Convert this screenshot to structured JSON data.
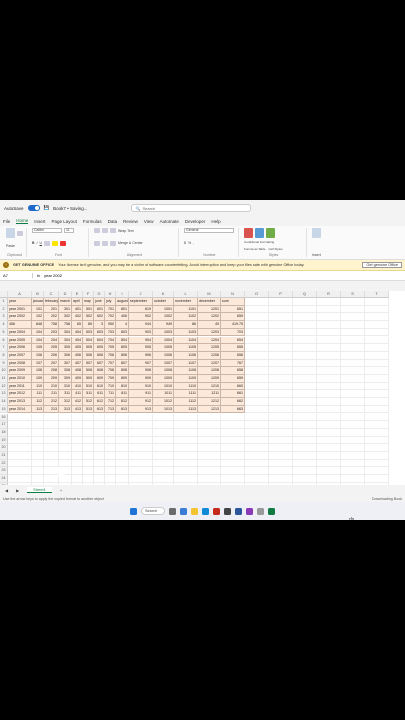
{
  "title": {
    "autosave_label": "AutoSave",
    "toggle_state": "On",
    "doc_name": "Book7 • Saving...",
    "search_placeholder": "Search"
  },
  "menu_tabs": [
    "File",
    "Home",
    "Insert",
    "Page Layout",
    "Formulas",
    "Data",
    "Review",
    "View",
    "Automate",
    "Developer",
    "Help"
  ],
  "active_tab": "Home",
  "ribbon": {
    "clipboard": "Clipboard",
    "paste": "Paste",
    "font_name": "Calibri",
    "font_size": "11",
    "font": "Font",
    "alignment": "Alignment",
    "wrap_text": "Wrap Text",
    "merge_center": "Merge & Center",
    "number_format": "General",
    "number": "Number",
    "conditional": "Conditional Formatting",
    "format_table": "Format as Table",
    "cell_styles": "Cell Styles",
    "styles": "Styles",
    "insert": "Insert",
    "undo": "Undo"
  },
  "banner": {
    "label": "GET GENUINE OFFICE",
    "message": "Your license isn't genuine, and you may be a victim of software counterfeiting. Avoid interruption and keep your files safe with genuine Office today.",
    "button": "Get genuine Office"
  },
  "formula_bar": {
    "name_box": "A7",
    "fx": "fx",
    "value": "year 2002"
  },
  "columns": [
    "A",
    "B",
    "C",
    "D",
    "E",
    "F",
    "G",
    "H",
    "I",
    "J",
    "K",
    "L",
    "M",
    "N",
    "O",
    "P",
    "Q",
    "R",
    "S",
    "T"
  ],
  "rows": [
    "1",
    "2",
    "3",
    "4",
    "5",
    "6",
    "7",
    "8",
    "9",
    "10",
    "11",
    "12",
    "13",
    "14",
    "15",
    "16",
    "17",
    "18",
    "19",
    "20",
    "21",
    "22",
    "23",
    "24",
    "25"
  ],
  "sheet": {
    "header": [
      "year",
      "january",
      "february",
      "march",
      "april",
      "may",
      "june",
      "july",
      "august",
      "september",
      "october",
      "november",
      "december",
      "sum"
    ],
    "data": [
      [
        "year 2001",
        "101",
        "201",
        "301",
        "401",
        "501",
        "601",
        "701",
        "801",
        "819",
        "1001",
        "1101",
        "1201",
        "651"
      ],
      [
        "year 2002",
        "102",
        "202",
        "302",
        "402",
        "502",
        "602",
        "702",
        "406",
        "902",
        "1002",
        "1102",
        "1202",
        "659"
      ],
      [
        "456",
        "848",
        "758",
        "758",
        "65",
        "85",
        "3",
        "950",
        "4",
        "944",
        "949",
        "86",
        "49",
        "419.75"
      ],
      [
        "year 2004",
        "104",
        "203",
        "304",
        "404",
        "503",
        "603",
        "703",
        "803",
        "903",
        "1003",
        "1103",
        "1203",
        "703"
      ],
      [
        "year 2005",
        "104",
        "204",
        "304",
        "404",
        "504",
        "604",
        "704",
        "804",
        "904",
        "1004",
        "1104",
        "1204",
        "654"
      ],
      [
        "year 2006",
        "105",
        "205",
        "305",
        "405",
        "505",
        "605",
        "705",
        "805",
        "905",
        "1005",
        "1105",
        "1205",
        "655"
      ],
      [
        "year 2007",
        "106",
        "206",
        "306",
        "406",
        "506",
        "606",
        "706",
        "806",
        "906",
        "1006",
        "1106",
        "1206",
        "656"
      ],
      [
        "year 2008",
        "107",
        "207",
        "307",
        "407",
        "507",
        "607",
        "707",
        "807",
        "907",
        "1007",
        "1107",
        "1207",
        "767"
      ],
      [
        "year 2009",
        "108",
        "208",
        "308",
        "408",
        "508",
        "608",
        "708",
        "808",
        "908",
        "1008",
        "1108",
        "1208",
        "658"
      ],
      [
        "year 2010",
        "109",
        "209",
        "309",
        "409",
        "509",
        "609",
        "709",
        "809",
        "909",
        "1009",
        "1109",
        "1209",
        "659"
      ],
      [
        "year 2011",
        "110",
        "210",
        "310",
        "410",
        "510",
        "610",
        "710",
        "810",
        "910",
        "1010",
        "1110",
        "1210",
        "660"
      ],
      [
        "year 2012",
        "111",
        "211",
        "311",
        "411",
        "511",
        "611",
        "711",
        "811",
        "911",
        "1011",
        "1111",
        "1211",
        "661"
      ],
      [
        "year 2013",
        "112",
        "212",
        "312",
        "412",
        "512",
        "612",
        "712",
        "812",
        "912",
        "1012",
        "1112",
        "1212",
        "662"
      ],
      [
        "year 2014",
        "113",
        "213",
        "313",
        "413",
        "513",
        "613",
        "713",
        "813",
        "913",
        "1013",
        "1113",
        "1213",
        "663"
      ]
    ]
  },
  "sheet_tab": "Sheet1",
  "status": {
    "left": "Use the arrow keys to apply the copied format to another object",
    "right": "Downloading Book"
  },
  "taskbar": {
    "search": "Search"
  },
  "stray_mark": "ds",
  "colors": {
    "excel_green": "#107c41",
    "data_fill": "#fde9d9",
    "banner_bg": "#fff4ce"
  }
}
